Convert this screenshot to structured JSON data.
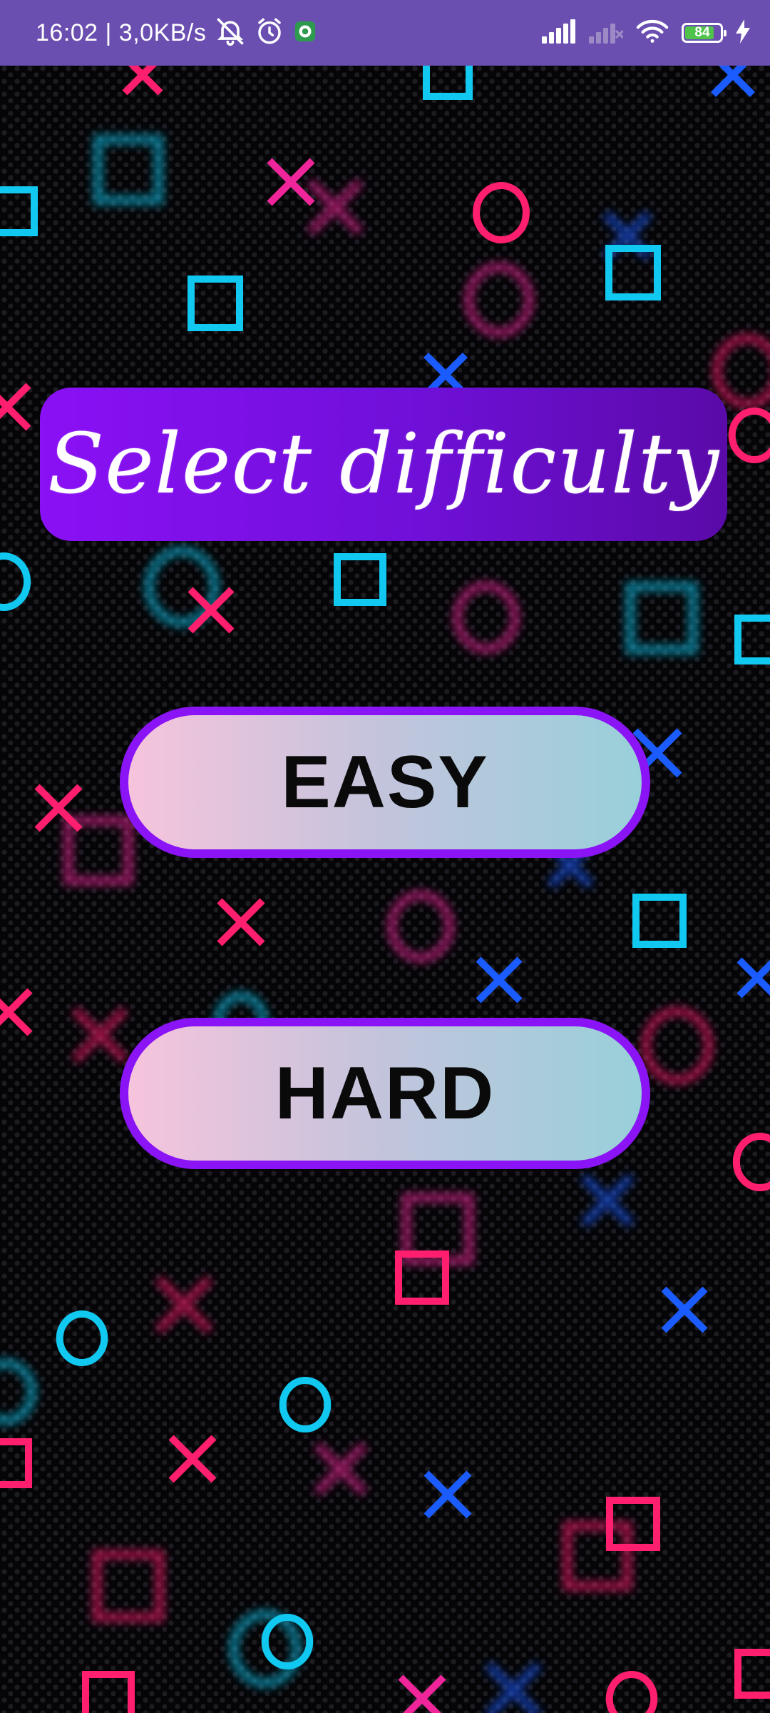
{
  "status_bar": {
    "time_speed": "16:02 | 3,0KB/s",
    "battery_level": "84",
    "battery_fraction": 0.84,
    "icons": [
      "mute-bell-icon",
      "alarm-icon",
      "app-notification-icon",
      "signal-icon",
      "signal-no-service-icon",
      "wifi-icon",
      "battery-icon",
      "charging-bolt-icon"
    ]
  },
  "screen": {
    "title": "Select difficulty",
    "buttons": {
      "easy_label": "EASY",
      "hard_label": "HARD"
    }
  },
  "colors": {
    "status_bar": "#6a4fb0",
    "banner": "#7a10e6",
    "button_border": "#8a14f5",
    "symbol_pink": "#ff1f6e",
    "symbol_magenta": "#f0259a",
    "symbol_cyan": "#11c8f0",
    "symbol_blue": "#1a5cff",
    "battery_green": "#4fc34a"
  }
}
